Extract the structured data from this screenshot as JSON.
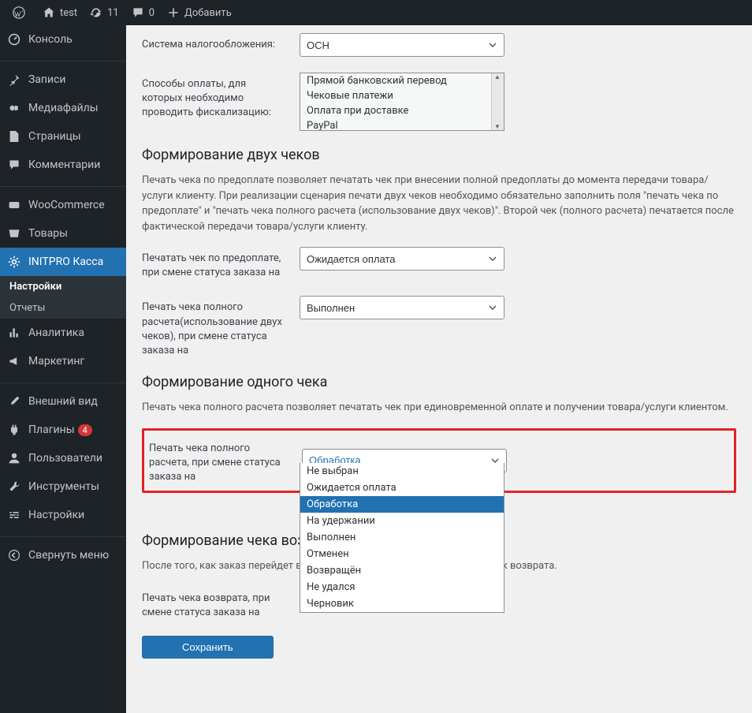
{
  "adminbar": {
    "site_name": "test",
    "updates_count": "11",
    "comments_count": "0",
    "add_new": "Добавить"
  },
  "sidebar": {
    "items": [
      {
        "label": "Консоль",
        "icon": "dashboard"
      },
      {
        "label": "Записи",
        "icon": "pin"
      },
      {
        "label": "Медиафайлы",
        "icon": "media"
      },
      {
        "label": "Страницы",
        "icon": "page"
      },
      {
        "label": "Комментарии",
        "icon": "comment"
      },
      {
        "label": "WooCommerce",
        "icon": "woo"
      },
      {
        "label": "Товары",
        "icon": "product"
      },
      {
        "label": "INITPRO Касса",
        "icon": "gear",
        "active": true
      },
      {
        "label": "Аналитика",
        "icon": "chart"
      },
      {
        "label": "Маркетинг",
        "icon": "megaphone"
      },
      {
        "label": "Внешний вид",
        "icon": "brush"
      },
      {
        "label": "Плагины",
        "icon": "plugin",
        "badge": "4"
      },
      {
        "label": "Пользователи",
        "icon": "user"
      },
      {
        "label": "Инструменты",
        "icon": "wrench"
      },
      {
        "label": "Настройки",
        "icon": "sliders"
      },
      {
        "label": "Свернуть меню",
        "icon": "collapse"
      }
    ],
    "submenu": [
      {
        "label": "Настройки",
        "active": true
      },
      {
        "label": "Отчеты"
      }
    ]
  },
  "form": {
    "tax_system": {
      "label": "Система налогообложения:",
      "value": "ОСН"
    },
    "payment_methods": {
      "label": "Способы оплаты, для которых необходимо проводить фискализацию:",
      "options": [
        "Прямой банковский перевод",
        "Чековые платежи",
        "Оплата при доставке",
        "PayPal"
      ]
    },
    "section_two_checks": {
      "title": "Формирование двух чеков",
      "desc": "Печать чека по предоплате позволяет печатать чек при внесении полной предоплаты до момента передачи товара/услуги клиенту. При реализации сценария печати двух чеков необходимо обязательно заполнить поля \"печать чека по предоплате\" и \"печать чека полного расчета (использование двух чеков)\". Второй чек (полного расчета) печатается после фактической передачи товара/услуги клиенту."
    },
    "prepay_check": {
      "label": "Печатать чек по предоплате, при смене статуса заказа на",
      "value": "Ожидается оплата"
    },
    "full_check_two": {
      "label": "Печать чека полного расчета(использование двух чеков), при смене статуса заказа на",
      "value": "Выполнен"
    },
    "section_one_check": {
      "title": "Формирование одного чека",
      "desc": "Печать чека полного расчета позволяет печатать чек при единовременной оплате и получении товара/услуги клиентом."
    },
    "full_check_one": {
      "label": "Печать чека полного расчета, при смене статуса заказа на",
      "value": "Обработка",
      "options": [
        "Не выбран",
        "Ожидается оплата",
        "Обработка",
        "На удержании",
        "Выполнен",
        "Отменен",
        "Возвращён",
        "Не удался",
        "Черновик"
      ]
    },
    "section_refund": {
      "title": "Формирование чека воз",
      "desc_prefix": "После того, как заказ перейдет в в",
      "desc_suffix": "ек возврата."
    },
    "refund_check": {
      "label": "Печать чека возврата, при смене статуса заказа на",
      "value": ""
    },
    "save_button": "Сохранить"
  }
}
